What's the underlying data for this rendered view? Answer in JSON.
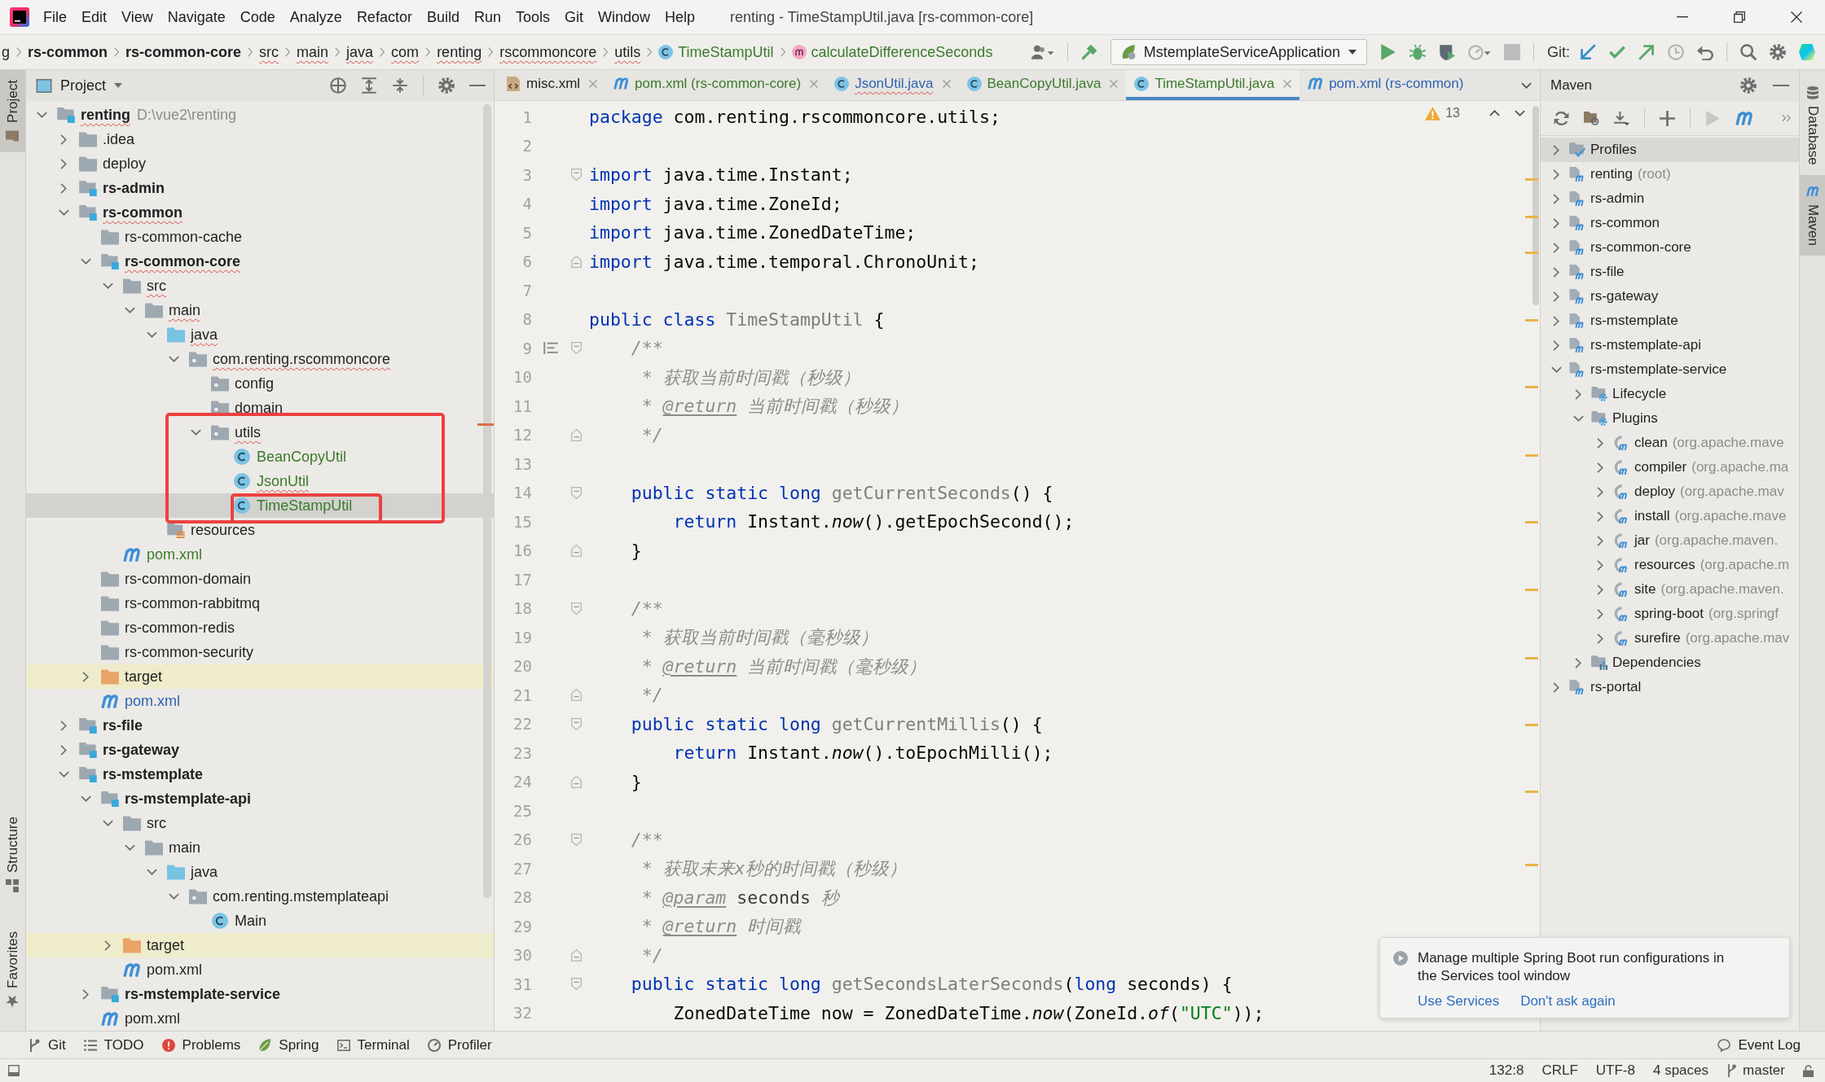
{
  "menu_bar": {
    "menus": [
      "File",
      "Edit",
      "View",
      "Navigate",
      "Code",
      "Analyze",
      "Refactor",
      "Build",
      "Run",
      "Tools",
      "Git",
      "Window",
      "Help"
    ],
    "title": "renting - TimeStampUtil.java [rs-common-core]"
  },
  "nav_bar": {
    "breadcrumbs": [
      {
        "label": "g",
        "kind": "plain",
        "error": false,
        "added": false
      },
      {
        "label": "rs-common",
        "kind": "module",
        "error": false,
        "added": false
      },
      {
        "label": "rs-common-core",
        "kind": "module",
        "error": false,
        "added": false
      },
      {
        "label": "src",
        "kind": "folder",
        "error": true,
        "added": false
      },
      {
        "label": "main",
        "kind": "folder",
        "error": true,
        "added": false
      },
      {
        "label": "java",
        "kind": "folder",
        "error": true,
        "added": false
      },
      {
        "label": "com",
        "kind": "folder",
        "error": true,
        "added": false
      },
      {
        "label": "renting",
        "kind": "folder",
        "error": true,
        "added": false
      },
      {
        "label": "rscommoncore",
        "kind": "folder",
        "error": true,
        "added": false
      },
      {
        "label": "utils",
        "kind": "folder",
        "error": true,
        "added": false
      },
      {
        "label": "TimeStampUtil",
        "kind": "class",
        "error": false,
        "added": true
      },
      {
        "label": "calculateDifferenceSeconds",
        "kind": "method",
        "error": false,
        "added": true
      }
    ],
    "run_configuration": "MstemplateServiceApplication",
    "git_label": "Git:"
  },
  "left_stripe": {
    "top": [
      {
        "label": "Project",
        "kind": "project",
        "selected": true
      }
    ],
    "bottom": [
      {
        "label": "Structure",
        "kind": "structure",
        "selected": false
      },
      {
        "label": "Favorites",
        "kind": "favorites",
        "selected": false
      }
    ]
  },
  "project_panel": {
    "title": "Project",
    "tree": [
      {
        "label": "renting",
        "hint": "D:\\vue2\\renting",
        "kind": "module",
        "expanded": true,
        "selected": false,
        "error": true,
        "added": false,
        "modified": false,
        "children": [
          {
            "label": ".idea",
            "kind": "folder",
            "expanded": false,
            "selected": false,
            "error": false,
            "added": false,
            "modified": false
          },
          {
            "label": "deploy",
            "kind": "folder",
            "expanded": false,
            "selected": false,
            "error": false,
            "added": false,
            "modified": false
          },
          {
            "label": "rs-admin",
            "kind": "module",
            "expanded": false,
            "selected": false,
            "error": false,
            "added": false,
            "modified": false
          },
          {
            "label": "rs-common",
            "kind": "module",
            "expanded": true,
            "selected": false,
            "error": true,
            "added": false,
            "modified": false,
            "children": [
              {
                "label": "rs-common-cache",
                "kind": "folder",
                "selected": false,
                "error": false,
                "added": false,
                "modified": false
              },
              {
                "label": "rs-common-core",
                "kind": "module",
                "expanded": true,
                "selected": false,
                "error": true,
                "added": false,
                "modified": false,
                "children": [
                  {
                    "label": "src",
                    "kind": "folder",
                    "expanded": true,
                    "selected": false,
                    "error": true,
                    "added": false,
                    "modified": false,
                    "children": [
                      {
                        "label": "main",
                        "kind": "folder",
                        "expanded": true,
                        "selected": false,
                        "error": true,
                        "added": false,
                        "modified": false,
                        "children": [
                          {
                            "label": "java",
                            "kind": "source-root",
                            "expanded": true,
                            "selected": false,
                            "error": true,
                            "added": false,
                            "modified": false,
                            "children": [
                              {
                                "label": "com.renting.rscommoncore",
                                "kind": "package",
                                "expanded": true,
                                "selected": false,
                                "error": true,
                                "added": false,
                                "modified": false,
                                "children": [
                                  {
                                    "label": "config",
                                    "kind": "package",
                                    "selected": false,
                                    "error": false,
                                    "added": false,
                                    "modified": false
                                  },
                                  {
                                    "label": "domain",
                                    "kind": "package",
                                    "selected": false,
                                    "error": false,
                                    "added": false,
                                    "modified": false
                                  },
                                  {
                                    "label": "utils",
                                    "kind": "package",
                                    "expanded": true,
                                    "selected": false,
                                    "error": true,
                                    "added": false,
                                    "modified": false,
                                    "children": [
                                      {
                                        "label": "BeanCopyUtil",
                                        "kind": "class",
                                        "selected": false,
                                        "error": false,
                                        "added": true,
                                        "modified": false
                                      },
                                      {
                                        "label": "JsonUtil",
                                        "kind": "class",
                                        "selected": false,
                                        "error": true,
                                        "added": true,
                                        "modified": false
                                      },
                                      {
                                        "label": "TimeStampUtil",
                                        "kind": "class",
                                        "selected": true,
                                        "error": false,
                                        "added": true,
                                        "modified": false
                                      }
                                    ]
                                  }
                                ]
                              }
                            ]
                          },
                          {
                            "label": "resources",
                            "kind": "resources",
                            "selected": false,
                            "error": false,
                            "added": false,
                            "modified": false
                          }
                        ]
                      }
                    ]
                  },
                  {
                    "label": "pom.xml",
                    "kind": "maven-file",
                    "selected": false,
                    "error": false,
                    "added": true,
                    "modified": false
                  }
                ]
              },
              {
                "label": "rs-common-domain",
                "kind": "folder",
                "selected": false,
                "error": false,
                "added": false,
                "modified": false
              },
              {
                "label": "rs-common-rabbitmq",
                "kind": "folder",
                "selected": false,
                "error": false,
                "added": false,
                "modified": false
              },
              {
                "label": "rs-common-redis",
                "kind": "folder",
                "selected": false,
                "error": false,
                "added": false,
                "modified": false
              },
              {
                "label": "rs-common-security",
                "kind": "folder",
                "selected": false,
                "error": false,
                "added": false,
                "modified": false
              },
              {
                "label": "target",
                "kind": "excluded",
                "expanded": false,
                "selected": false,
                "error": false,
                "added": false,
                "modified": false
              },
              {
                "label": "pom.xml",
                "kind": "maven-file",
                "selected": false,
                "error": false,
                "added": false,
                "modified": true
              }
            ]
          },
          {
            "label": "rs-file",
            "kind": "module",
            "expanded": false,
            "selected": false,
            "error": false,
            "added": false,
            "modified": false
          },
          {
            "label": "rs-gateway",
            "kind": "module",
            "expanded": false,
            "selected": false,
            "error": false,
            "added": false,
            "modified": false
          },
          {
            "label": "rs-mstemplate",
            "kind": "module",
            "expanded": true,
            "selected": false,
            "error": false,
            "added": false,
            "modified": false,
            "children": [
              {
                "label": "rs-mstemplate-api",
                "kind": "module",
                "expanded": true,
                "selected": false,
                "error": false,
                "added": false,
                "modified": false,
                "children": [
                  {
                    "label": "src",
                    "kind": "folder",
                    "expanded": true,
                    "selected": false,
                    "error": false,
                    "added": false,
                    "modified": false,
                    "children": [
                      {
                        "label": "main",
                        "kind": "folder",
                        "expanded": true,
                        "selected": false,
                        "error": false,
                        "added": false,
                        "modified": false,
                        "children": [
                          {
                            "label": "java",
                            "kind": "source-root",
                            "expanded": true,
                            "selected": false,
                            "error": false,
                            "added": false,
                            "modified": false,
                            "children": [
                              {
                                "label": "com.renting.mstemplateapi",
                                "kind": "package",
                                "expanded": true,
                                "selected": false,
                                "error": false,
                                "added": false,
                                "modified": false,
                                "children": [
                                  {
                                    "label": "Main",
                                    "kind": "class",
                                    "selected": false,
                                    "error": false,
                                    "added": false,
                                    "modified": false
                                  }
                                ]
                              }
                            ]
                          }
                        ]
                      }
                    ]
                  },
                  {
                    "label": "target",
                    "kind": "excluded",
                    "expanded": false,
                    "selected": false,
                    "error": false,
                    "added": false,
                    "modified": false
                  },
                  {
                    "label": "pom.xml",
                    "kind": "maven-file",
                    "selected": false,
                    "error": false,
                    "added": false,
                    "modified": false
                  }
                ]
              },
              {
                "label": "rs-mstemplate-service",
                "kind": "module",
                "expanded": false,
                "selected": false,
                "error": false,
                "added": false,
                "modified": false
              },
              {
                "label": "pom.xml",
                "kind": "maven-file",
                "selected": false,
                "error": false,
                "added": false,
                "modified": false
              }
            ]
          }
        ]
      }
    ]
  },
  "editor": {
    "tabs": [
      {
        "label": "misc.xml",
        "kind": "xml",
        "selected": false,
        "closable": true,
        "error": false,
        "added": false,
        "modified": false
      },
      {
        "label": "pom.xml (rs-common-core)",
        "kind": "maven",
        "selected": false,
        "closable": true,
        "error": false,
        "added": true,
        "modified": false
      },
      {
        "label": "JsonUtil.java",
        "kind": "class",
        "selected": false,
        "closable": true,
        "error": true,
        "added": false,
        "modified": true
      },
      {
        "label": "BeanCopyUtil.java",
        "kind": "class",
        "selected": false,
        "closable": true,
        "error": false,
        "added": true,
        "modified": false
      },
      {
        "label": "TimeStampUtil.java",
        "kind": "class",
        "selected": true,
        "closable": true,
        "error": false,
        "added": true,
        "modified": false
      },
      {
        "label": "pom.xml (rs-common)",
        "kind": "maven",
        "selected": false,
        "closable": false,
        "error": false,
        "added": false,
        "modified": true
      }
    ],
    "warnings": "13",
    "lines": [
      {
        "number": "1",
        "kind": "plain",
        "render_doc": false,
        "tokens": [
          {
            "kind": "keyword",
            "text": "package"
          },
          {
            "kind": "plain",
            "text": " com.renting.rscommoncore.utils;"
          }
        ]
      },
      {
        "number": "2",
        "kind": "plain",
        "render_doc": false
      },
      {
        "number": "3",
        "kind": "fold-start",
        "render_doc": false,
        "tokens": [
          {
            "kind": "keyword",
            "text": "import"
          },
          {
            "kind": "plain",
            "text": " java.time.Instant;"
          }
        ]
      },
      {
        "number": "4",
        "kind": "plain",
        "render_doc": false,
        "tokens": [
          {
            "kind": "keyword",
            "text": "import"
          },
          {
            "kind": "plain",
            "text": " java.time.ZoneId;"
          }
        ]
      },
      {
        "number": "5",
        "kind": "plain",
        "render_doc": false,
        "tokens": [
          {
            "kind": "keyword",
            "text": "import"
          },
          {
            "kind": "plain",
            "text": " java.time.ZonedDateTime;"
          }
        ]
      },
      {
        "number": "6",
        "kind": "fold-end",
        "render_doc": false,
        "tokens": [
          {
            "kind": "keyword",
            "text": "import"
          },
          {
            "kind": "plain",
            "text": " java.time.temporal.ChronoUnit;"
          }
        ]
      },
      {
        "number": "7",
        "kind": "plain",
        "render_doc": false
      },
      {
        "number": "8",
        "kind": "plain",
        "render_doc": false,
        "tokens": [
          {
            "kind": "keyword",
            "text": "public class"
          },
          {
            "kind": "unused",
            "text": " TimeStampUtil"
          },
          {
            "kind": "plain",
            "text": " {"
          }
        ]
      },
      {
        "number": "9",
        "kind": "fold-start",
        "render_doc": true,
        "tokens": [
          {
            "kind": "comment",
            "text": "    /**"
          }
        ]
      },
      {
        "number": "10",
        "kind": "plain",
        "render_doc": false,
        "tokens": [
          {
            "kind": "comment",
            "text": "     * 获取当前时间戳（秒级）"
          }
        ]
      },
      {
        "number": "11",
        "kind": "plain",
        "render_doc": false,
        "tokens": [
          {
            "kind": "comment",
            "text": "     * "
          },
          {
            "kind": "doctag",
            "text": "@return"
          },
          {
            "kind": "comment",
            "text": " 当前时间戳（秒级）"
          }
        ]
      },
      {
        "number": "12",
        "kind": "fold-end",
        "render_doc": false,
        "tokens": [
          {
            "kind": "comment",
            "text": "     */"
          }
        ]
      },
      {
        "number": "13",
        "kind": "plain",
        "render_doc": false
      },
      {
        "number": "14",
        "kind": "fold-start",
        "render_doc": false,
        "tokens": [
          {
            "kind": "keyword",
            "text": "    public static long"
          },
          {
            "kind": "unused",
            "text": " getCurrentSeconds"
          },
          {
            "kind": "plain",
            "text": "() {"
          }
        ]
      },
      {
        "number": "15",
        "kind": "plain",
        "render_doc": false,
        "tokens": [
          {
            "kind": "keyword",
            "text": "        return"
          },
          {
            "kind": "plain",
            "text": " Instant."
          },
          {
            "kind": "static",
            "text": "now"
          },
          {
            "kind": "plain",
            "text": "().getEpochSecond();"
          }
        ]
      },
      {
        "number": "16",
        "kind": "fold-end",
        "render_doc": false,
        "tokens": [
          {
            "kind": "plain",
            "text": "    }"
          }
        ]
      },
      {
        "number": "17",
        "kind": "plain",
        "render_doc": false
      },
      {
        "number": "18",
        "kind": "fold-start",
        "render_doc": false,
        "tokens": [
          {
            "kind": "comment",
            "text": "    /**"
          }
        ]
      },
      {
        "number": "19",
        "kind": "plain",
        "render_doc": false,
        "tokens": [
          {
            "kind": "comment",
            "text": "     * 获取当前时间戳（毫秒级）"
          }
        ]
      },
      {
        "number": "20",
        "kind": "plain",
        "render_doc": false,
        "tokens": [
          {
            "kind": "comment",
            "text": "     * "
          },
          {
            "kind": "doctag",
            "text": "@return"
          },
          {
            "kind": "comment",
            "text": " 当前时间戳（毫秒级）"
          }
        ]
      },
      {
        "number": "21",
        "kind": "fold-end",
        "render_doc": false,
        "tokens": [
          {
            "kind": "comment",
            "text": "     */"
          }
        ]
      },
      {
        "number": "22",
        "kind": "fold-start",
        "render_doc": false,
        "tokens": [
          {
            "kind": "keyword",
            "text": "    public static long"
          },
          {
            "kind": "unused",
            "text": " getCurrentMillis"
          },
          {
            "kind": "plain",
            "text": "() {"
          }
        ]
      },
      {
        "number": "23",
        "kind": "plain",
        "render_doc": false,
        "tokens": [
          {
            "kind": "keyword",
            "text": "        return"
          },
          {
            "kind": "plain",
            "text": " Instant."
          },
          {
            "kind": "static",
            "text": "now"
          },
          {
            "kind": "plain",
            "text": "().toEpochMilli();"
          }
        ]
      },
      {
        "number": "24",
        "kind": "fold-end",
        "render_doc": false,
        "tokens": [
          {
            "kind": "plain",
            "text": "    }"
          }
        ]
      },
      {
        "number": "25",
        "kind": "plain",
        "render_doc": false
      },
      {
        "number": "26",
        "kind": "fold-start",
        "render_doc": false,
        "tokens": [
          {
            "kind": "comment",
            "text": "    /**"
          }
        ]
      },
      {
        "number": "27",
        "kind": "plain",
        "render_doc": false,
        "tokens": [
          {
            "kind": "comment",
            "text": "     * 获取未来x秒的时间戳（秒级）"
          }
        ]
      },
      {
        "number": "28",
        "kind": "plain",
        "render_doc": false,
        "tokens": [
          {
            "kind": "comment",
            "text": "     * "
          },
          {
            "kind": "doctag",
            "text": "@param"
          },
          {
            "kind": "param",
            "text": " seconds"
          },
          {
            "kind": "comment",
            "text": " 秒"
          }
        ]
      },
      {
        "number": "29",
        "kind": "plain",
        "render_doc": false,
        "tokens": [
          {
            "kind": "comment",
            "text": "     * "
          },
          {
            "kind": "doctag",
            "text": "@return"
          },
          {
            "kind": "comment",
            "text": " 时间戳"
          }
        ]
      },
      {
        "number": "30",
        "kind": "fold-end",
        "render_doc": false,
        "tokens": [
          {
            "kind": "comment",
            "text": "     */"
          }
        ]
      },
      {
        "number": "31",
        "kind": "fold-start",
        "render_doc": false,
        "tokens": [
          {
            "kind": "keyword",
            "text": "    public static long"
          },
          {
            "kind": "unused",
            "text": " getSecondsLaterSeconds"
          },
          {
            "kind": "plain",
            "text": "("
          },
          {
            "kind": "keyword",
            "text": "long"
          },
          {
            "kind": "plain",
            "text": " seconds) {"
          }
        ]
      },
      {
        "number": "32",
        "kind": "plain",
        "render_doc": false,
        "tokens": [
          {
            "kind": "plain",
            "text": "        ZonedDateTime now = ZonedDateTime."
          },
          {
            "kind": "static",
            "text": "now"
          },
          {
            "kind": "plain",
            "text": "(ZoneId."
          },
          {
            "kind": "static",
            "text": "of"
          },
          {
            "kind": "plain",
            "text": "("
          },
          {
            "kind": "string",
            "text": "\"UTC\""
          },
          {
            "kind": "plain",
            "text": "));"
          }
        ]
      }
    ]
  },
  "maven_panel": {
    "title": "Maven",
    "tree": [
      {
        "label": "Profiles",
        "kind": "profiles",
        "expanded": false,
        "selected": true
      },
      {
        "label": "renting",
        "hint": "(root)",
        "kind": "module",
        "expanded": false,
        "selected": false
      },
      {
        "label": "rs-admin",
        "kind": "module",
        "expanded": false,
        "selected": false
      },
      {
        "label": "rs-common",
        "kind": "module",
        "expanded": false,
        "selected": false
      },
      {
        "label": "rs-common-core",
        "kind": "module",
        "expanded": false,
        "selected": false
      },
      {
        "label": "rs-file",
        "kind": "module",
        "expanded": false,
        "selected": false
      },
      {
        "label": "rs-gateway",
        "kind": "module",
        "expanded": false,
        "selected": false
      },
      {
        "label": "rs-mstemplate",
        "kind": "module",
        "expanded": false,
        "selected": false
      },
      {
        "label": "rs-mstemplate-api",
        "kind": "module",
        "expanded": false,
        "selected": false
      },
      {
        "label": "rs-mstemplate-service",
        "kind": "module",
        "expanded": true,
        "selected": false,
        "children": [
          {
            "label": "Lifecycle",
            "kind": "goals-folder",
            "expanded": false,
            "selected": false
          },
          {
            "label": "Plugins",
            "kind": "goals-folder",
            "expanded": true,
            "selected": false,
            "children": [
              {
                "label": "clean",
                "hint": "(org.apache.mave",
                "kind": "plugin",
                "expanded": false,
                "selected": false
              },
              {
                "label": "compiler",
                "hint": "(org.apache.ma",
                "kind": "plugin",
                "expanded": false,
                "selected": false
              },
              {
                "label": "deploy",
                "hint": "(org.apache.mav",
                "kind": "plugin",
                "expanded": false,
                "selected": false
              },
              {
                "label": "install",
                "hint": "(org.apache.mave",
                "kind": "plugin",
                "expanded": false,
                "selected": false
              },
              {
                "label": "jar",
                "hint": "(org.apache.maven.",
                "kind": "plugin",
                "expanded": false,
                "selected": false
              },
              {
                "label": "resources",
                "hint": "(org.apache.m",
                "kind": "plugin",
                "expanded": false,
                "selected": false
              },
              {
                "label": "site",
                "hint": "(org.apache.maven.",
                "kind": "plugin",
                "expanded": false,
                "selected": false
              },
              {
                "label": "spring-boot",
                "hint": "(org.springf",
                "kind": "plugin",
                "expanded": false,
                "selected": false
              },
              {
                "label": "surefire",
                "hint": "(org.apache.mav",
                "kind": "plugin",
                "expanded": false,
                "selected": false
              }
            ]
          },
          {
            "label": "Dependencies",
            "kind": "dependencies",
            "expanded": false,
            "selected": false
          }
        ]
      },
      {
        "label": "rs-portal",
        "kind": "module",
        "expanded": false,
        "selected": false
      }
    ]
  },
  "right_stripe": [
    {
      "label": "Database",
      "kind": "database",
      "selected": false
    },
    {
      "label": "Maven",
      "kind": "maven",
      "selected": true
    }
  ],
  "notification": {
    "message": "Manage multiple Spring Boot run configurations in the Services tool window",
    "actions": [
      "Use Services",
      "Don't ask again"
    ]
  },
  "tool_window_bar": {
    "left": [
      {
        "label": "Git",
        "kind": "git"
      },
      {
        "label": "TODO",
        "kind": "todo"
      },
      {
        "label": "Problems",
        "kind": "problems"
      },
      {
        "label": "Spring",
        "kind": "spring"
      },
      {
        "label": "Terminal",
        "kind": "terminal"
      },
      {
        "label": "Profiler",
        "kind": "profiler"
      }
    ],
    "right": [
      {
        "label": "Event Log",
        "kind": "event-log"
      }
    ]
  },
  "status_bar": {
    "items": [
      "132:8",
      "CRLF",
      "UTF-8",
      "4 spaces"
    ],
    "branch": "master"
  }
}
